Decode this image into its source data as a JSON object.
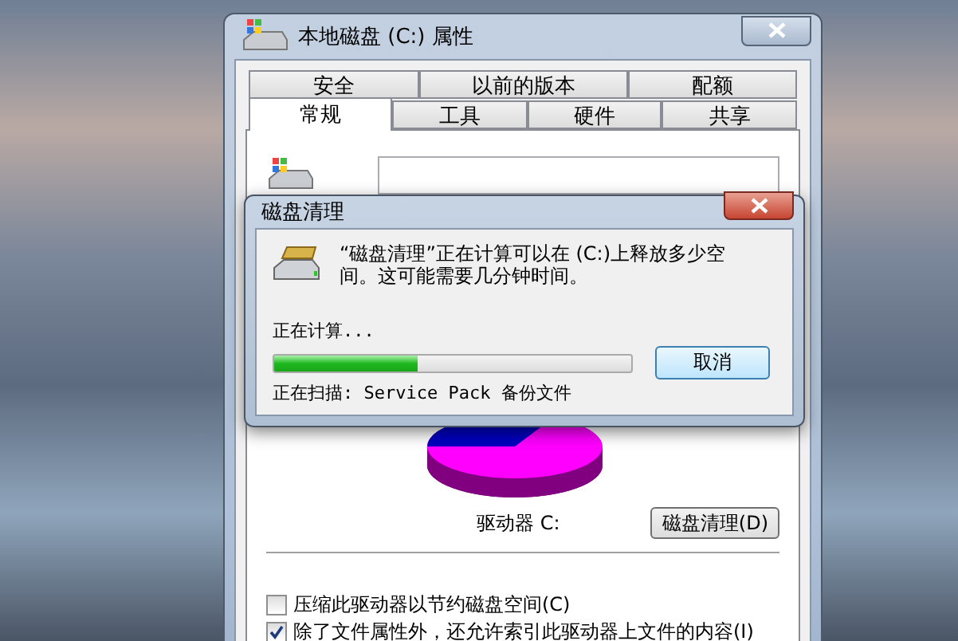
{
  "window": {
    "title": "本地磁盘 (C:) 属性"
  },
  "tabs_back_row": [
    {
      "label": "安全",
      "selected": false
    },
    {
      "label": "以前的版本",
      "selected": false
    },
    {
      "label": "配额",
      "selected": false
    }
  ],
  "tabs_front_row": [
    {
      "label": "常规",
      "selected": true
    },
    {
      "label": "工具",
      "selected": false
    },
    {
      "label": "硬件",
      "selected": false
    },
    {
      "label": "共享",
      "selected": false
    }
  ],
  "drive_label": "驱动器 C:",
  "cleanup_button": "磁盘清理(D)",
  "checkboxes": [
    {
      "label": "压缩此驱动器以节约磁盘空间(C)",
      "checked": false
    },
    {
      "label": "除了文件属性外，还允许索引此驱动器上文件的内容(I)",
      "checked": true
    }
  ],
  "cleanup_dialog": {
    "title": "磁盘清理",
    "message": "“磁盘清理”正在计算可以在 (C:)上释放多少空间。这可能需要几分钟时间。",
    "status": "正在计算...",
    "level": 0.4,
    "scanning": "正在扫描: Service Pack 备份文件",
    "cancel": "取消"
  }
}
